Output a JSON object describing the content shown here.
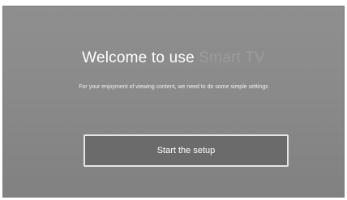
{
  "welcome": {
    "title_prefix": "Welcome to use",
    "title_brand": "Smart TV",
    "subtitle": "For your enjoyment of viewing content, we need to do some simple settings",
    "start_button_label": "Start the setup"
  }
}
